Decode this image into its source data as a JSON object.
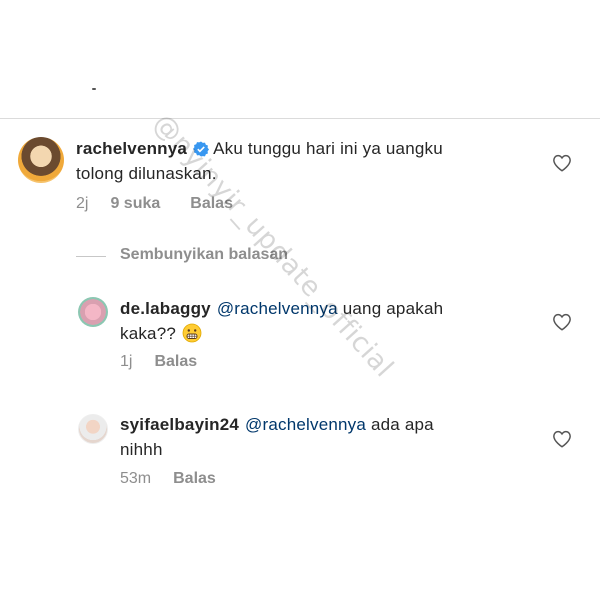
{
  "watermark": "@nyinyir_update_official",
  "comment": {
    "username": "rachelvennya",
    "text_line1": "Aku tunggu hari ini ya uangku",
    "text_line2": "tolong dilunaskan.",
    "time": "2j",
    "likes": "9 suka",
    "reply_label": "Balas"
  },
  "hide_replies_label": "Sembunyikan balasan",
  "replies": [
    {
      "username": "de.labaggy",
      "mention": "@rachelvennya",
      "text_line1": "uang apakah",
      "text_line2": "kaka??",
      "emoji": "grimacing-face",
      "time": "1j",
      "reply_label": "Balas"
    },
    {
      "username": "syifaelbayin24",
      "mention": "@rachelvennya",
      "text_line1": "ada apa",
      "text_line2": "nihhh",
      "time": "53m",
      "reply_label": "Balas"
    }
  ],
  "colors": {
    "text": "#262626",
    "meta": "#8e8e8e",
    "mention": "#00376b",
    "verified": "#3897f0"
  }
}
